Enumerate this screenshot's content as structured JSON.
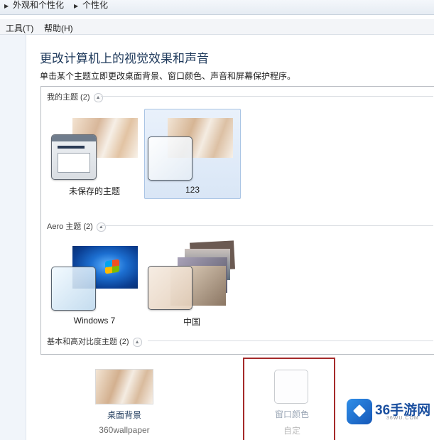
{
  "breadcrumb": {
    "items": [
      "外观和个性化",
      "个性化"
    ]
  },
  "menu": {
    "tools": "工具(T)",
    "help": "帮助(H)"
  },
  "page": {
    "title": "更改计算机上的视觉效果和声音",
    "subtitle": "单击某个主题立即更改桌面背景、窗口颜色、声音和屏幕保护程序。"
  },
  "groups": {
    "my_themes": "我的主题 (2)",
    "aero_themes": "Aero 主题 (2)",
    "basic_themes": "基本和高对比度主题 (2)"
  },
  "themes": {
    "unsaved": "未保存的主题",
    "custom": "123",
    "windows7": "Windows 7",
    "china": "中国"
  },
  "settings": {
    "desktop_background": "桌面背景",
    "desktop_background_value": "360wallpaper",
    "window_color": "窗口颜色",
    "window_color_value": "自定"
  },
  "watermark": {
    "main": "36手游网",
    "sub": "36WU.COM"
  },
  "colors": {
    "selection_border": "#a9c4e4",
    "highlight_box": "#a52a2a",
    "heading": "#1e395b"
  },
  "icons": [
    "chevron-right-icon",
    "chevron-up-icon",
    "cube-logo-icon"
  ]
}
